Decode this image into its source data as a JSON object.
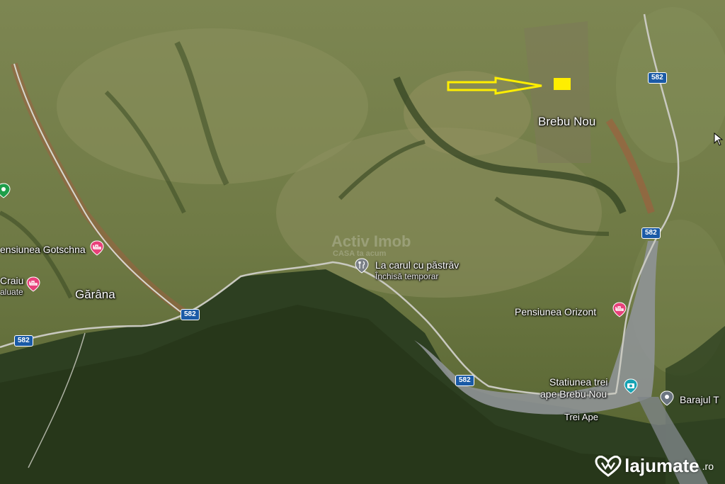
{
  "labels": {
    "brebu_nou": "Brebu Nou",
    "garana": "Gărâna",
    "la_carul": "La carul cu păstrăv",
    "la_carul_status": "Închisă temporar",
    "pensiunea_gotschna": "ensiunea Gotschna",
    "craiu": "Craiu",
    "craiu_sub": "aluate",
    "pensiunea_orizont": "Pensiunea Orizont",
    "statiunea_line1": "Statiunea trei",
    "statiunea_line2": "ape Brebu Nou",
    "barajul": "Barajul T",
    "trei_ape": "Trei Ape"
  },
  "roads": {
    "r1": "582",
    "r2": "582",
    "r3": "582",
    "r4": "582",
    "r5": "582"
  },
  "watermark": {
    "main": "Activ Imob",
    "sub": "CASA ta acum"
  },
  "brand": {
    "name": "lajumate",
    "tld": ".ro"
  },
  "colors": {
    "highlight": "#ffee00",
    "road_shield": "#1a5aa6",
    "pin_pink": "#e8417a",
    "pin_teal": "#16a3b3",
    "pin_gray": "#6b7580",
    "pin_green": "#1e9e4a"
  }
}
